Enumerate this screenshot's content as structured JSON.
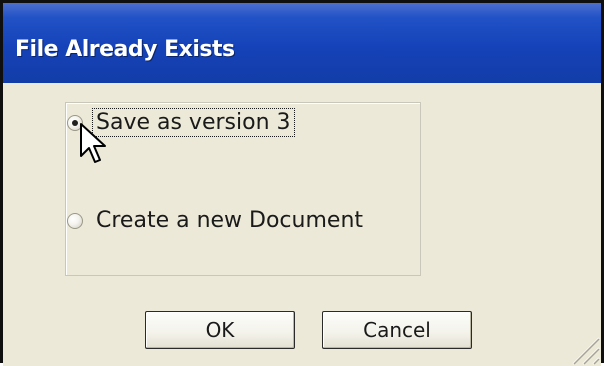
{
  "window": {
    "title": "File Already Exists"
  },
  "options": [
    {
      "label": "Save as version 3",
      "checked": true,
      "focused": true
    },
    {
      "label": "Create a new Document",
      "checked": false,
      "focused": false
    }
  ],
  "buttons": {
    "ok_label": "OK",
    "cancel_label": "Cancel"
  },
  "icons": {
    "cursor": "arrow-cursor-icon",
    "resize": "resize-grip-icon"
  },
  "colors": {
    "titlebar": "#2152c6",
    "dialog_bg": "#ece9d8",
    "title_text": "#ffffff"
  }
}
